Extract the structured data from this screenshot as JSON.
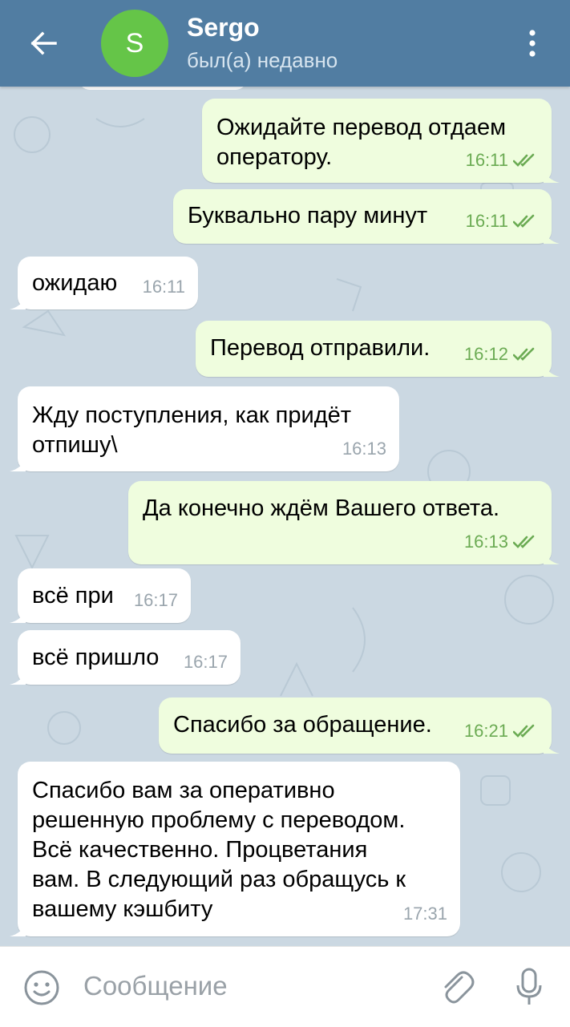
{
  "header": {
    "title": "Sergo",
    "status": "был(а) недавно",
    "avatar_letter": "S",
    "avatar_color": "#65c548",
    "bar_color": "#517da2",
    "back_icon": "arrow-left-icon",
    "menu_icon": "more-vertical-icon"
  },
  "messages": [
    {
      "dir": "out",
      "text": "Ожидайте перевод отдаем\nоператору.",
      "time": "16:11",
      "read": true
    },
    {
      "dir": "out",
      "text": "Буквально пару минут",
      "time": "16:11",
      "read": true
    },
    {
      "dir": "in",
      "text": "ожидаю",
      "time": "16:11"
    },
    {
      "dir": "out",
      "text": "Перевод отправили.",
      "time": "16:12",
      "read": true
    },
    {
      "dir": "in",
      "text": "Жду поступления, как придёт\nотпишу\\",
      "time": "16:13"
    },
    {
      "dir": "out",
      "text": "Да конечно ждём Вашего ответа.",
      "time": "16:13",
      "read": true
    },
    {
      "dir": "in",
      "text": "всё при",
      "time": "16:17"
    },
    {
      "dir": "in",
      "text": "всё пришло",
      "time": "16:17"
    },
    {
      "dir": "out",
      "text": "Спасибо за обращение.",
      "time": "16:21",
      "read": true
    },
    {
      "dir": "in",
      "text": "Спасибо вам за оперативно\nрешенную проблему с переводом.\nВсё качественно. Процветания\nвам. В следующий раз обращусь к\nвашему кэшбиту",
      "time": "17:31"
    }
  ],
  "input": {
    "placeholder": "Сообщение",
    "emoji_icon": "emoji-icon",
    "attach_icon": "paperclip-icon",
    "mic_icon": "microphone-icon"
  },
  "colors": {
    "chat_background": "#cbd8e2",
    "outgoing_bubble": "#effdde",
    "incoming_bubble": "#ffffff",
    "outgoing_meta": "#6bab53",
    "incoming_meta": "#9aa5ad"
  }
}
